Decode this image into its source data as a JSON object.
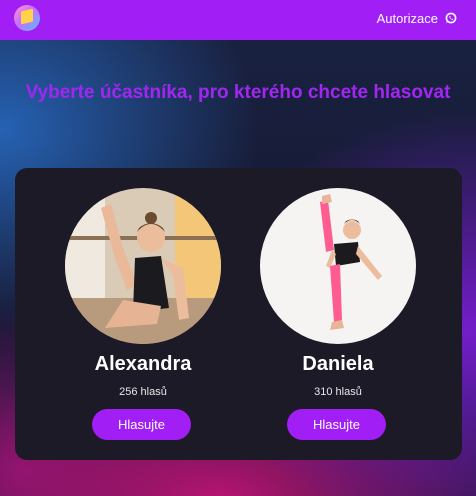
{
  "header": {
    "auth_label": "Autorizace",
    "logo_icon": "app-logo-icon",
    "chat_icon": "whatsapp-icon"
  },
  "main": {
    "headline": "Vyberte účastníka, pro kterého chcete hlasovat"
  },
  "participants": [
    {
      "name": "Alexandra",
      "votes": "256 hlasů",
      "button_label": "Hlasujte"
    },
    {
      "name": "Daniela",
      "votes": "310 hlasů",
      "button_label": "Hlasujte"
    }
  ],
  "colors": {
    "accent": "#a11ef4",
    "panel": "#1c1a26",
    "headline": "#a226f2"
  }
}
